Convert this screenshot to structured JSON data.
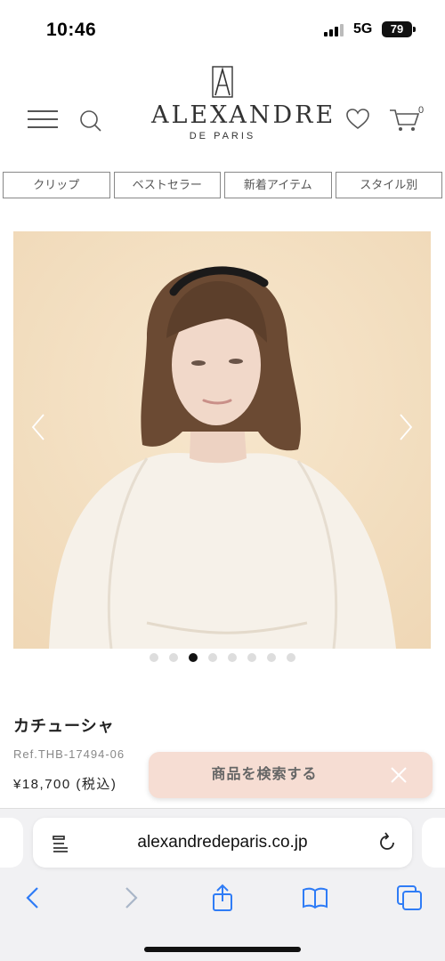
{
  "status": {
    "time": "10:46",
    "network": "5G",
    "battery": "79"
  },
  "header": {
    "logo_name": "ALEXANDRE",
    "logo_sub": "DE PARIS",
    "cart_count": "0"
  },
  "categories": [
    {
      "label": "クリップ"
    },
    {
      "label": "ベストセラー"
    },
    {
      "label": "新着アイテム"
    },
    {
      "label": "スタイル別"
    }
  ],
  "carousel": {
    "total": 8,
    "active_index": 2
  },
  "product": {
    "name": "カチューシャ",
    "ref": "Ref.THB-17494-06",
    "price": "¥18,700 (税込)"
  },
  "search_float": {
    "label": "商品を検索する"
  },
  "browser": {
    "url": "alexandredeparis.co.jp"
  },
  "colors": {
    "hero_background": "#f3e0c3",
    "search_float_bg": "#f6ddd3",
    "accent_blue": "#2f7cf6"
  }
}
